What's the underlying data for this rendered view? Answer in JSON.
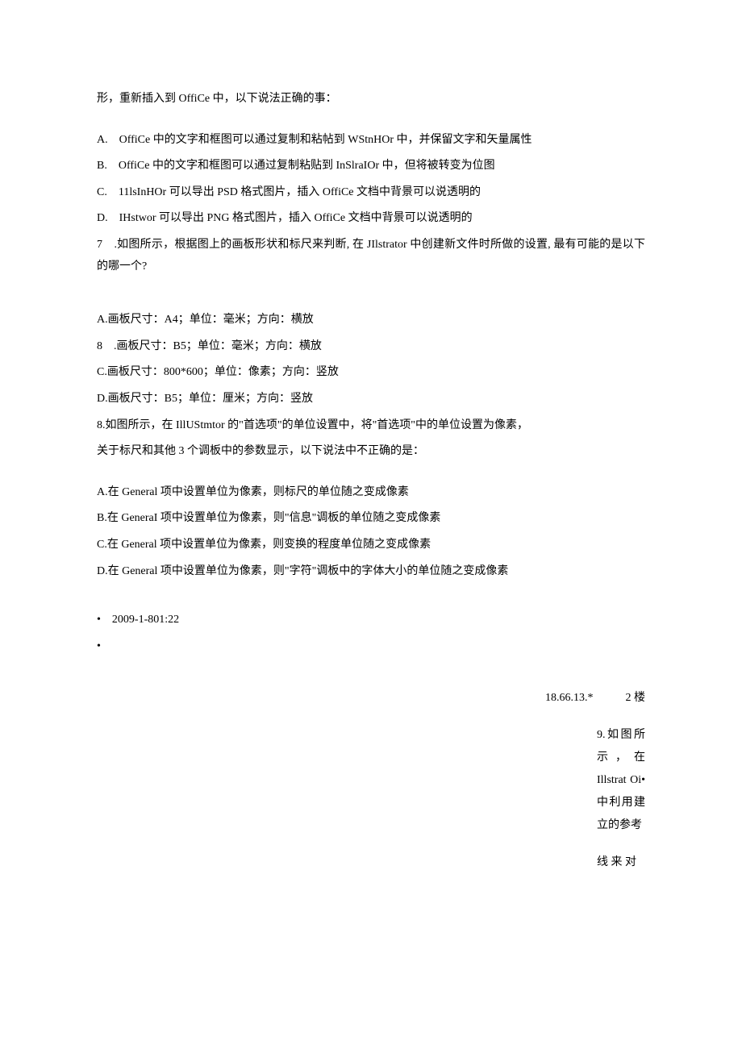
{
  "intro_line": "形，重新插入到 OffiCe 中，以下说法正确的事：",
  "q6_options": {
    "A": "A.　OffiCe 中的文字和框图可以通过复制和粘帖到 WStnHOr 中，并保留文字和矢量属性",
    "B": "B.　OffiCe 中的文字和框图可以通过复制粘贴到 InSlraIOr 中，但将被转变为位图",
    "C": "C.　11lsInHOr 可以导出 PSD 格式图片，插入 OffiCe 文档中背景可以说透明的",
    "D": "D.　IHstwor 可以导出 PNG 格式图片，插入 OffiCe 文档中背景可以说透明的"
  },
  "q7_stem": "7　.如图所示，根据图上的画板形状和标尺来判断, 在 JIlstrator 中创建新文件时所做的设置, 最有可能的是以下的哪一个?",
  "q7_options": {
    "A": "A.画板尺寸：A4；单位：毫米；方向：横放",
    "B": "8　.画板尺寸：B5；单位：毫米；方向：横放",
    "C": "C.画板尺寸：800*600；单位：像素；方向：竖放",
    "D": "D.画板尺寸：B5；单位：厘米；方向：竖放"
  },
  "q8_stem_1": "8.如图所示，在 IllUStmtor 的\"首选项\"的单位设置中，将\"首选项\"中的单位设置为像素，",
  "q8_stem_2": "关于标尺和其他 3 个调板中的参数显示，以下说法中不正确的是：",
  "q8_options": {
    "A": "A.在 General 项中设置单位为像素，则标尺的单位随之变成像素",
    "B": "B.在 GeneraI 项中设置单位为像素，则\"信息\"调板的单位随之变成像素",
    "C": "C.在 General 项中设置单位为像素，则变换的程度单位随之变成像素",
    "D": "D.在 General 项中设置单位为像素，则\"字符\"调板中的字体大小的单位随之变成像素"
  },
  "meta": {
    "bullet1": "•　2009-1-801:22",
    "bullet2": "•",
    "ip": "18.66.13.*",
    "floor": "2 楼"
  },
  "q9_block1": "9.如图所示，在 Illstrat Oi•中利用建立的参考",
  "q9_block2": "线 来 对"
}
